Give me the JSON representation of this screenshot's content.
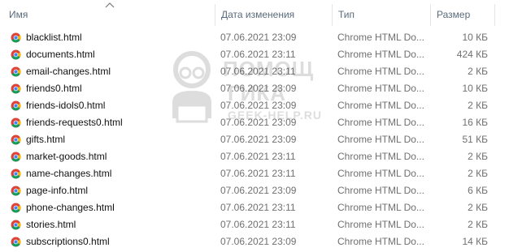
{
  "header": {
    "name": "Имя",
    "date": "Дата изменения",
    "type": "Тип",
    "size": "Размер"
  },
  "watermark": {
    "line1": "ПОМОЩ",
    "line2": "ГИКА",
    "line3": "GEEK-HELP.RU"
  },
  "colors": {
    "chrome_red": "#db4437",
    "chrome_green": "#0f9d58",
    "chrome_yellow": "#f4b400",
    "chrome_blue": "#4285f4"
  },
  "files": [
    {
      "icon": "chrome-html-icon",
      "name": "blacklist.html",
      "date": "07.06.2021 23:09",
      "type": "Chrome HTML Do...",
      "size": "10 КБ"
    },
    {
      "icon": "chrome-html-icon",
      "name": "documents.html",
      "date": "07.06.2021 23:11",
      "type": "Chrome HTML Do...",
      "size": "424 КБ"
    },
    {
      "icon": "chrome-html-icon",
      "name": "email-changes.html",
      "date": "07.06.2021 23:11",
      "type": "Chrome HTML Do...",
      "size": "2 КБ"
    },
    {
      "icon": "chrome-html-icon",
      "name": "friends0.html",
      "date": "07.06.2021 23:09",
      "type": "Chrome HTML Do...",
      "size": "10 КБ"
    },
    {
      "icon": "chrome-html-icon",
      "name": "friends-idols0.html",
      "date": "07.06.2021 23:09",
      "type": "Chrome HTML Do...",
      "size": "2 КБ"
    },
    {
      "icon": "chrome-html-icon",
      "name": "friends-requests0.html",
      "date": "07.06.2021 23:09",
      "type": "Chrome HTML Do...",
      "size": "16 КБ"
    },
    {
      "icon": "chrome-html-icon",
      "name": "gifts.html",
      "date": "07.06.2021 23:09",
      "type": "Chrome HTML Do...",
      "size": "51 КБ"
    },
    {
      "icon": "chrome-html-icon",
      "name": "market-goods.html",
      "date": "07.06.2021 23:11",
      "type": "Chrome HTML Do...",
      "size": "2 КБ"
    },
    {
      "icon": "chrome-html-icon",
      "name": "name-changes.html",
      "date": "07.06.2021 23:11",
      "type": "Chrome HTML Do...",
      "size": "2 КБ"
    },
    {
      "icon": "chrome-html-icon",
      "name": "page-info.html",
      "date": "07.06.2021 23:09",
      "type": "Chrome HTML Do...",
      "size": "6 КБ"
    },
    {
      "icon": "chrome-html-icon",
      "name": "phone-changes.html",
      "date": "07.06.2021 23:11",
      "type": "Chrome HTML Do...",
      "size": "2 КБ"
    },
    {
      "icon": "chrome-html-icon",
      "name": "stories.html",
      "date": "07.06.2021 23:11",
      "type": "Chrome HTML Do...",
      "size": "2 КБ"
    },
    {
      "icon": "chrome-html-icon",
      "name": "subscriptions0.html",
      "date": "07.06.2021 23:09",
      "type": "Chrome HTML Do...",
      "size": "14 КБ"
    }
  ]
}
